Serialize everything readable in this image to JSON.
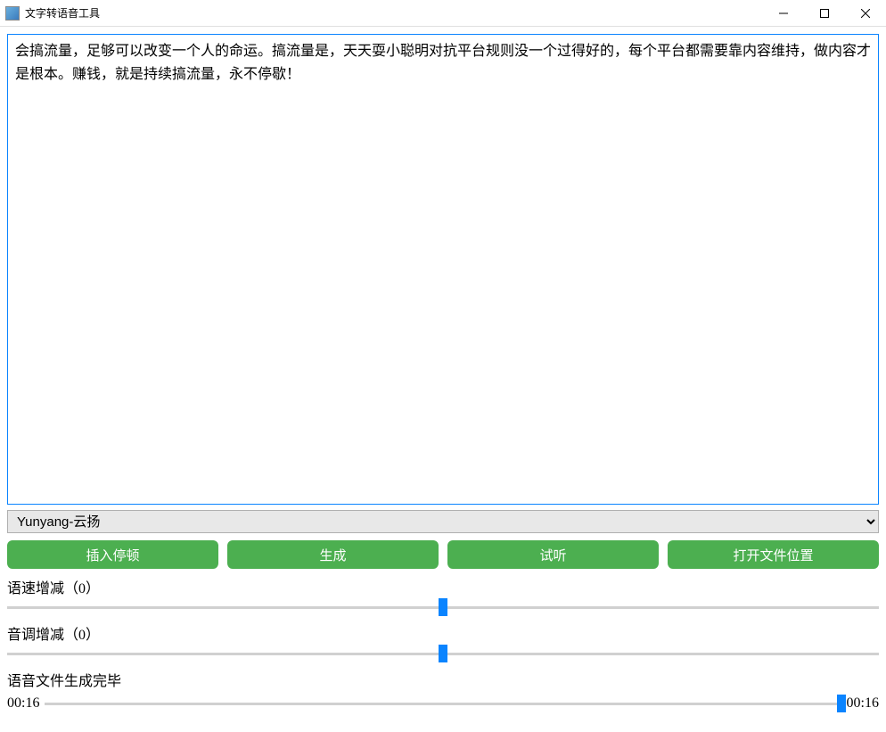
{
  "window": {
    "title": "文字转语音工具"
  },
  "textInput": {
    "value": "会搞流量，足够可以改变一个人的命运。搞流量是，天天耍小聪明对抗平台规则没一个过得好的，每个平台都需要靠内容维持，做内容才是根本。赚钱，就是持续搞流量，永不停歇！"
  },
  "voice": {
    "selected": "Yunyang-云扬"
  },
  "buttons": {
    "insertPause": "插入停顿",
    "generate": "生成",
    "preview": "试听",
    "openFolder": "打开文件位置"
  },
  "sliders": {
    "speed": {
      "label": "语速增减（0）",
      "value": 0,
      "min": -100,
      "max": 100,
      "percent": 50
    },
    "pitch": {
      "label": "音调增减（0）",
      "value": 0,
      "min": -100,
      "max": 100,
      "percent": 50
    }
  },
  "status": {
    "text": "语音文件生成完毕"
  },
  "playback": {
    "currentTime": "00:16",
    "totalTime": "00:16",
    "percent": 100
  }
}
